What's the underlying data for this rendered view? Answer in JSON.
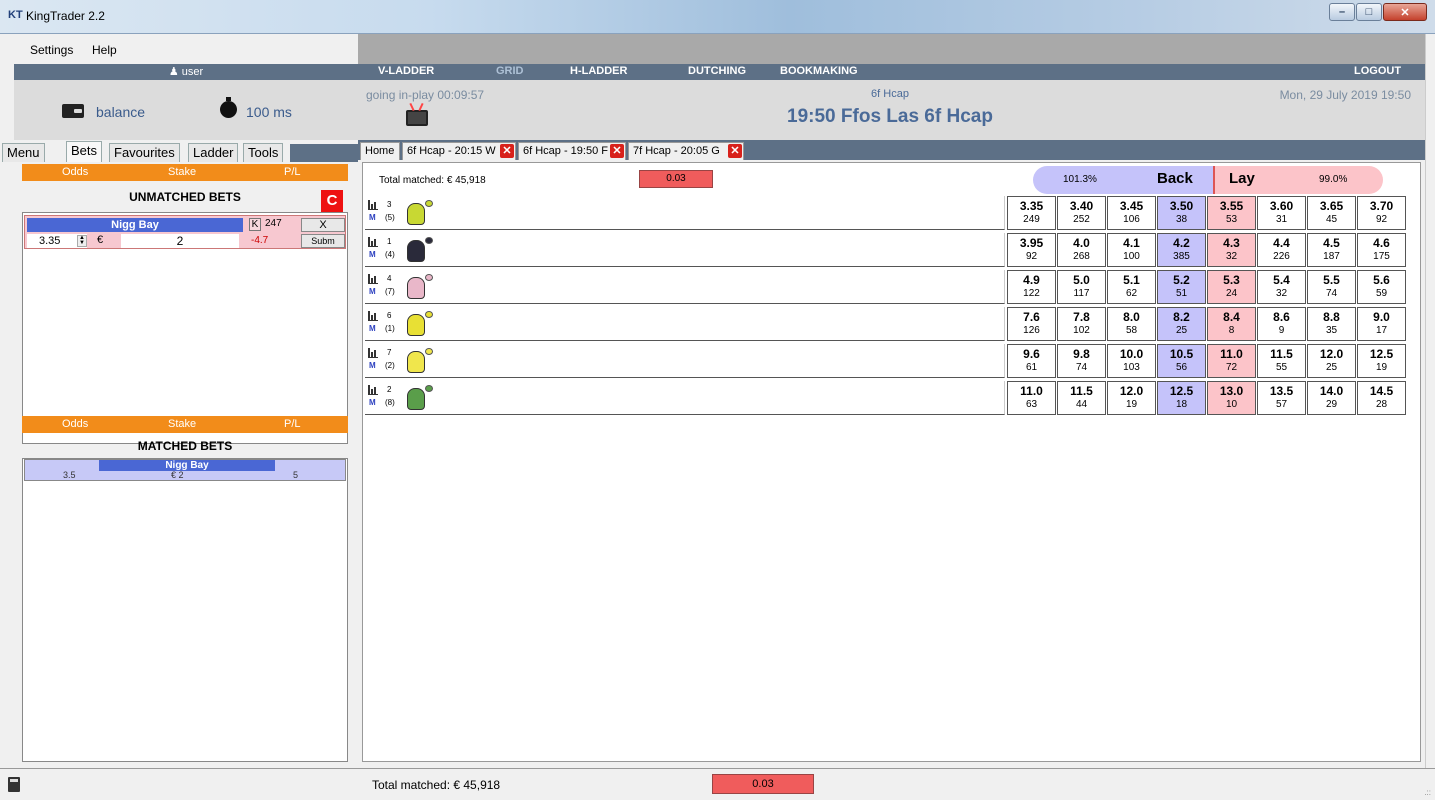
{
  "window": {
    "logo": "KT",
    "title": "KingTrader 2.2",
    "minimize": "–",
    "maximize": "□",
    "close": "✕"
  },
  "menu": {
    "settings": "Settings",
    "help": "Help"
  },
  "user": {
    "name": "user",
    "balance": "balance",
    "latency": "100 ms"
  },
  "left_tabs": [
    "Menu",
    "Bets",
    "Favourites",
    "Ladder",
    "Tools"
  ],
  "bets_header": {
    "odds": "Odds",
    "stake": "Stake",
    "pl": "P/L"
  },
  "unmatched": {
    "title": "UNMATCHED BETS",
    "cancel_all": "C",
    "bet": {
      "runner": "Nigg Bay",
      "k": "K",
      "k_value": "247",
      "cancel": "X",
      "submit": "Subm",
      "odds": "3.35",
      "currency": "€",
      "stake": "2",
      "pl": "-4.7"
    }
  },
  "matched": {
    "title": "MATCHED BETS",
    "bet": {
      "runner": "Nigg Bay",
      "odds": "3.5",
      "stake": "€ 2",
      "pl": "5"
    }
  },
  "nav": {
    "items": [
      "V-LADDER",
      "GRID",
      "H-LADDER",
      "DUTCHING",
      "BOOKMAKING"
    ],
    "active": "GRID",
    "logout": "LOGOUT"
  },
  "event": {
    "inplay": "going in-play 00:09:57",
    "category": "6f Hcap",
    "name": "19:50 Ffos Las 6f Hcap",
    "date": "Mon, 29 July 2019 19:50"
  },
  "market_tabs": {
    "home": "Home",
    "tabs": [
      "6f Hcap - 20:15 W",
      "6f Hcap - 19:50 F",
      "7f Hcap - 20:05 G"
    ],
    "close": "✕"
  },
  "market": {
    "total_matched": "Total matched: € 45,918",
    "last_price": "0.03",
    "back_pct": "101.3%",
    "back_label": "Back",
    "lay_label": "Lay",
    "lay_pct": "99.0%"
  },
  "runners": [
    {
      "num": "3",
      "draw": "(5)",
      "m": "M",
      "prices": [
        [
          "3.35",
          "249"
        ],
        [
          "3.40",
          "252"
        ],
        [
          "3.45",
          "106"
        ],
        [
          "3.50",
          "38"
        ],
        [
          "3.55",
          "53"
        ],
        [
          "3.60",
          "31"
        ],
        [
          "3.65",
          "45"
        ],
        [
          "3.70",
          "92"
        ]
      ]
    },
    {
      "num": "1",
      "draw": "(4)",
      "m": "M",
      "prices": [
        [
          "3.95",
          "92"
        ],
        [
          "4.0",
          "268"
        ],
        [
          "4.1",
          "100"
        ],
        [
          "4.2",
          "385"
        ],
        [
          "4.3",
          "32"
        ],
        [
          "4.4",
          "226"
        ],
        [
          "4.5",
          "187"
        ],
        [
          "4.6",
          "175"
        ]
      ]
    },
    {
      "num": "4",
      "draw": "(7)",
      "m": "M",
      "prices": [
        [
          "4.9",
          "122"
        ],
        [
          "5.0",
          "117"
        ],
        [
          "5.1",
          "62"
        ],
        [
          "5.2",
          "51"
        ],
        [
          "5.3",
          "24"
        ],
        [
          "5.4",
          "32"
        ],
        [
          "5.5",
          "74"
        ],
        [
          "5.6",
          "59"
        ]
      ]
    },
    {
      "num": "6",
      "draw": "(1)",
      "m": "M",
      "prices": [
        [
          "7.6",
          "126"
        ],
        [
          "7.8",
          "102"
        ],
        [
          "8.0",
          "58"
        ],
        [
          "8.2",
          "25"
        ],
        [
          "8.4",
          "8"
        ],
        [
          "8.6",
          "9"
        ],
        [
          "8.8",
          "35"
        ],
        [
          "9.0",
          "17"
        ]
      ]
    },
    {
      "num": "7",
      "draw": "(2)",
      "m": "M",
      "prices": [
        [
          "9.6",
          "61"
        ],
        [
          "9.8",
          "74"
        ],
        [
          "10.0",
          "103"
        ],
        [
          "10.5",
          "56"
        ],
        [
          "11.0",
          "72"
        ],
        [
          "11.5",
          "55"
        ],
        [
          "12.0",
          "25"
        ],
        [
          "12.5",
          "19"
        ]
      ]
    },
    {
      "num": "2",
      "draw": "(8)",
      "m": "M",
      "prices": [
        [
          "11.0",
          "63"
        ],
        [
          "11.5",
          "44"
        ],
        [
          "12.0",
          "19"
        ],
        [
          "12.5",
          "18"
        ],
        [
          "13.0",
          "10"
        ],
        [
          "13.5",
          "57"
        ],
        [
          "14.0",
          "29"
        ],
        [
          "14.5",
          "28"
        ]
      ]
    }
  ],
  "silks": [
    "#c8d833",
    "#2a2a3a",
    "#e9b7c9",
    "#e8e034",
    "#f0e64c",
    "#5a9e4a"
  ],
  "status": {
    "total_matched": "Total matched: € 45,918",
    "last_price": "0.03",
    "grip": ".::"
  }
}
